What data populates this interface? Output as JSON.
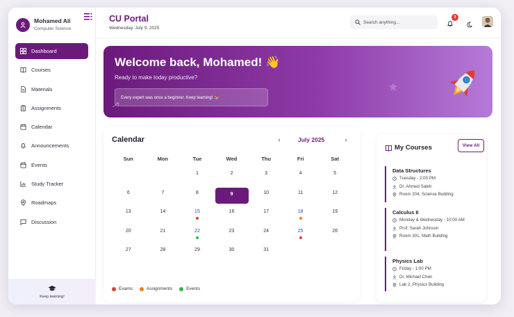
{
  "profile": {
    "name": "Mohamed Ali",
    "department": "Computer Science"
  },
  "sidebar": {
    "items": [
      {
        "label": "Dashboard",
        "icon": "dashboard-icon",
        "active": true
      },
      {
        "label": "Courses",
        "icon": "book-icon"
      },
      {
        "label": "Materials",
        "icon": "document-icon"
      },
      {
        "label": "Assignments",
        "icon": "clipboard-icon"
      },
      {
        "label": "Calendar",
        "icon": "calendar-icon"
      },
      {
        "label": "Announcements",
        "icon": "bell-icon"
      },
      {
        "label": "Events",
        "icon": "calendar-icon"
      },
      {
        "label": "Study Tracker",
        "icon": "chart-icon"
      },
      {
        "label": "Roadmaps",
        "icon": "map-pin-icon"
      },
      {
        "label": "Discussion",
        "icon": "chat-icon"
      }
    ],
    "footer_text": "Keep learning!"
  },
  "header": {
    "title": "CU Portal",
    "date": "Wednesday, July 9, 2025",
    "search_placeholder": "Search anything...",
    "notification_count": "3"
  },
  "banner": {
    "title": "Welcome back, Mohamed! 👋",
    "subtitle": "Ready to make today productive?",
    "quote": "Every expert was once a beginner. Keep learning! 📚"
  },
  "calendar": {
    "title": "Calendar",
    "prev": "‹",
    "next": "›",
    "month": "July 2025",
    "weekdays": [
      "Sun",
      "Mon",
      "Tue",
      "Wed",
      "Thu",
      "Fri",
      "Sat"
    ],
    "weeks": [
      [
        "",
        "",
        "1",
        "2",
        "3",
        "4",
        "5"
      ],
      [
        "6",
        "7",
        "8",
        "9",
        "10",
        "11",
        "12"
      ],
      [
        "13",
        "14",
        "15",
        "16",
        "17",
        "18",
        "19"
      ],
      [
        "20",
        "21",
        "22",
        "23",
        "24",
        "25",
        "26"
      ],
      [
        "27",
        "28",
        "29",
        "30",
        "31",
        "",
        ""
      ]
    ],
    "today": "9",
    "events": {
      "15": "exam",
      "18": "assignment",
      "22": "event",
      "25": "exam"
    },
    "legend": [
      {
        "label": "Exams",
        "color": "#e53935"
      },
      {
        "label": "Assignments",
        "color": "#f57c00"
      },
      {
        "label": "Events",
        "color": "#2eb84c"
      }
    ]
  },
  "courses": {
    "title": "My Courses",
    "view_all": "View All",
    "items": [
      {
        "name": "Data Structures",
        "schedule": "Tuesday - 2:00 PM",
        "instructor": "Dr. Ahmed Saleh",
        "location": "Room 204, Science Building"
      },
      {
        "name": "Calculus II",
        "schedule": "Monday & Wednesday - 10:00 AM",
        "instructor": "Prof. Sarah Johnson",
        "location": "Room 301, Math Building"
      },
      {
        "name": "Physics Lab",
        "schedule": "Friday - 1:00 PM",
        "instructor": "Dr. Michael Chen",
        "location": "Lab 2, Physics Building"
      }
    ]
  },
  "colors": {
    "primary": "#6b1a7b",
    "exam": "#e53935",
    "assignment": "#f57c00",
    "event": "#2eb84c"
  }
}
